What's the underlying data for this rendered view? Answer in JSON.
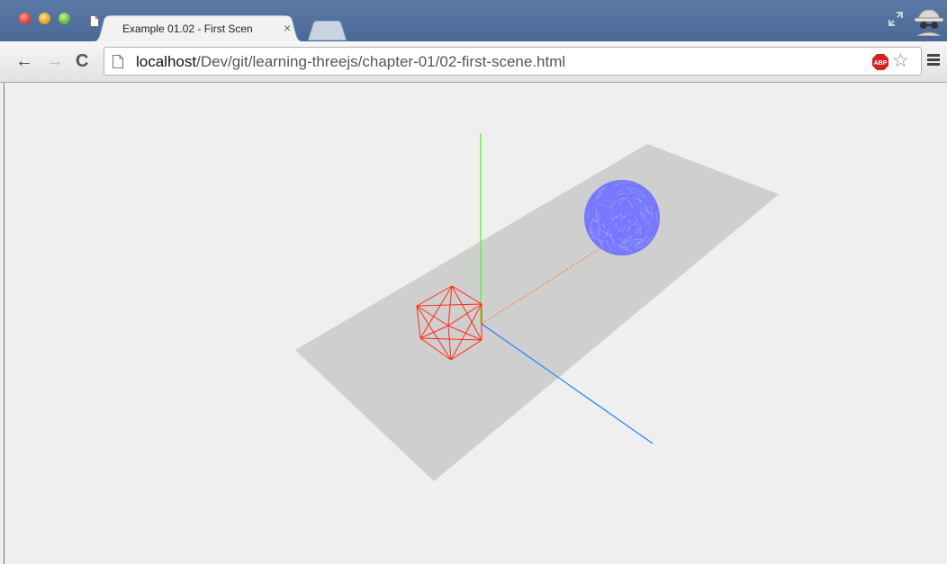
{
  "window": {
    "tab": {
      "title": "Example 01.02 - First Scen",
      "close_glyph": "×",
      "icon": "page-icon"
    },
    "controls": [
      "close",
      "minimize",
      "zoom"
    ]
  },
  "toolbar": {
    "back_glyph": "←",
    "forward_glyph": "→",
    "reload_glyph": "C",
    "url_host": "localhost",
    "url_path": "/Dev/git/learning-threejs/chapter-01/02-first-scene.html",
    "star_glyph": "☆",
    "extensions": [
      "adblock-icon"
    ]
  },
  "scene": {
    "background": "#efefef",
    "plane_color": "#cfcfcf",
    "cube_color": "#ff2a1a",
    "sphere_color": "#7777ff",
    "axis_colors": {
      "x": "#ff8040",
      "y": "#40ff10",
      "z": "#2080ff"
    },
    "objects": [
      "plane",
      "cube",
      "sphere",
      "axes"
    ]
  }
}
